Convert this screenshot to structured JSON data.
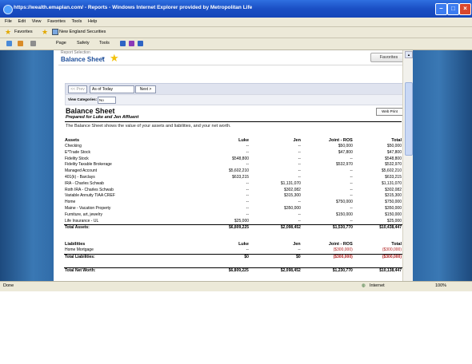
{
  "window": {
    "title": "https://wealth.emaplan.com/ - Reports - Windows Internet Explorer provided by Metropolitan Life",
    "menu": [
      "File",
      "Edit",
      "View",
      "Favorites",
      "Tools",
      "Help"
    ],
    "favorites_label": "Favorites",
    "fav_link": "New England Securities",
    "toolbar": {
      "page": "Page",
      "safety": "Safety",
      "tools": "Tools"
    },
    "status_left": "Done",
    "status_zone": "Internet",
    "zoom": "100%"
  },
  "report": {
    "selection_label": "Report Selection",
    "selected_report": "Balance Sheet",
    "favorites_button": "Favorites",
    "prev_button": "<< Prev",
    "as_of": "As of Today",
    "next_button": "Next >",
    "view_categories_label": "View Categories:",
    "view_categories_value": "No",
    "title": "Balance Sheet",
    "prepared_for": "Prepared for Luke and Jen Affluent",
    "description": "The Balance Sheet shows the value of your assets and liabilities, and your net worth.",
    "web_print": "Web Print"
  },
  "assets": {
    "headers": [
      "Assets",
      "Luke",
      "Jen",
      "Joint - ROS",
      "Total"
    ],
    "rows": [
      [
        "Checking",
        "--",
        "--",
        "$50,000",
        "$50,000"
      ],
      [
        "E*Trade Stock",
        "--",
        "--",
        "$47,800",
        "$47,800"
      ],
      [
        "Fidelity Stock",
        "$548,800",
        "--",
        "--",
        "$548,800"
      ],
      [
        "Fidelity Taxable Brokerage",
        "--",
        "--",
        "$532,970",
        "$532,970"
      ],
      [
        "Managed Account",
        "$5,602,210",
        "--",
        "--",
        "$5,602,210"
      ],
      [
        "401(k) - Barclays",
        "$633,215",
        "--",
        "--",
        "$633,215"
      ],
      [
        "IRA - Charles Schwab",
        "--",
        "$1,131,070",
        "--",
        "$1,131,070"
      ],
      [
        "Roth IRA - Charles Schwab",
        "--",
        "$302,082",
        "--",
        "$302,082"
      ],
      [
        "Variable Annuity TIAA CREF",
        "--",
        "$315,300",
        "--",
        "$315,300"
      ],
      [
        "Home",
        "--",
        "--",
        "$750,000",
        "$750,000"
      ],
      [
        "Maine - Vacation Property",
        "--",
        "$350,000",
        "--",
        "$350,000"
      ],
      [
        "Furniture, art, jewelry",
        "--",
        "--",
        "$150,000",
        "$150,000"
      ],
      [
        "Life Insurance - UL",
        "$25,000",
        "--",
        "--",
        "$25,000"
      ]
    ],
    "total": [
      "Total Assets:",
      "$6,809,225",
      "$2,098,452",
      "$1,530,770",
      "$10,438,447"
    ]
  },
  "liabilities": {
    "headers": [
      "Liabilities",
      "Luke",
      "Jen",
      "Joint - ROS",
      "Total"
    ],
    "rows": [
      [
        "Home Mortgage",
        "--",
        "--",
        "($300,000)",
        "($300,000)"
      ]
    ],
    "total": [
      "Total Liabilities:",
      "$0",
      "$0",
      "($300,000)",
      "($300,000)"
    ]
  },
  "net_worth": [
    "Total Net Worth:",
    "$6,809,225",
    "$2,098,452",
    "$1,230,770",
    "$10,138,447"
  ]
}
